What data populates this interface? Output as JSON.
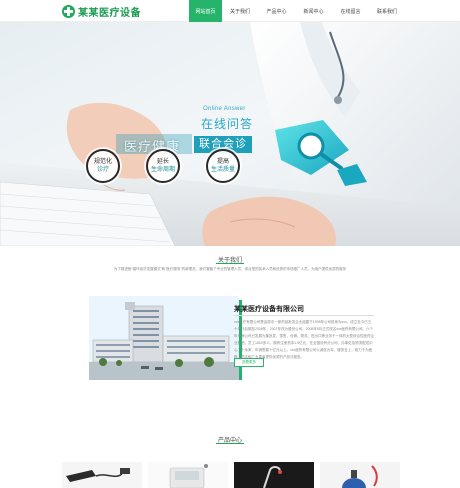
{
  "header": {
    "logo_text": "某某医疗设备",
    "nav": [
      {
        "label": "网站首页",
        "active": true
      },
      {
        "label": "关于我们",
        "active": false
      },
      {
        "label": "产品中心",
        "active": false
      },
      {
        "label": "新闻中心",
        "active": false
      },
      {
        "label": "在线留言",
        "active": false
      },
      {
        "label": "联系我们",
        "active": false
      }
    ]
  },
  "banner": {
    "en_title": "Online Answer",
    "cn_title": "在线问答",
    "slogan_left": "医疗健康",
    "slogan_right": "联合会诊",
    "badges": [
      {
        "line1": "规范化",
        "line2": "诊疗"
      },
      {
        "line1": "延长",
        "line2": "生命周期"
      },
      {
        "line1": "提高",
        "line2": "生活质量"
      }
    ]
  },
  "about": {
    "title": "关于我们",
    "desc": "为了推进医“循环经济发展模式”和“医疗服务”的新理念，我们凝聚了专业的管理人员、综合型的技术人员和优秀的市场推广人员，为用户提供优质的服务",
    "company_name": "某某医疗设备有限公司",
    "company_text": "xxx医疗有限公司是由原中一家药品批发企业组建于1995年公司前身为xxx。成立至今已五十年代后期至2008年，2007年改为股份公司，2008年5月正式改名xxx医药有限公司。六个年来我公司已发展为集批发、零售、仓储、物流、进出口等业务于一体的大型综合性医药企业集团，员工1600多人，拥有注册资本1.5亿元，在全国设有分公司、办事处及物流配送中心二十余家，年销售额十亿元以上。xxx医药有限公司以诚信为本，服务至上，致力于为医院、药店和广大患者提供优质的产品与服务。",
    "more_label": "查看更多"
  },
  "products": {
    "title": "产品中心"
  },
  "colors": {
    "brand_green": "#1faa59",
    "nav_active": "#26b36a",
    "banner_teal": "#1e9fba"
  }
}
